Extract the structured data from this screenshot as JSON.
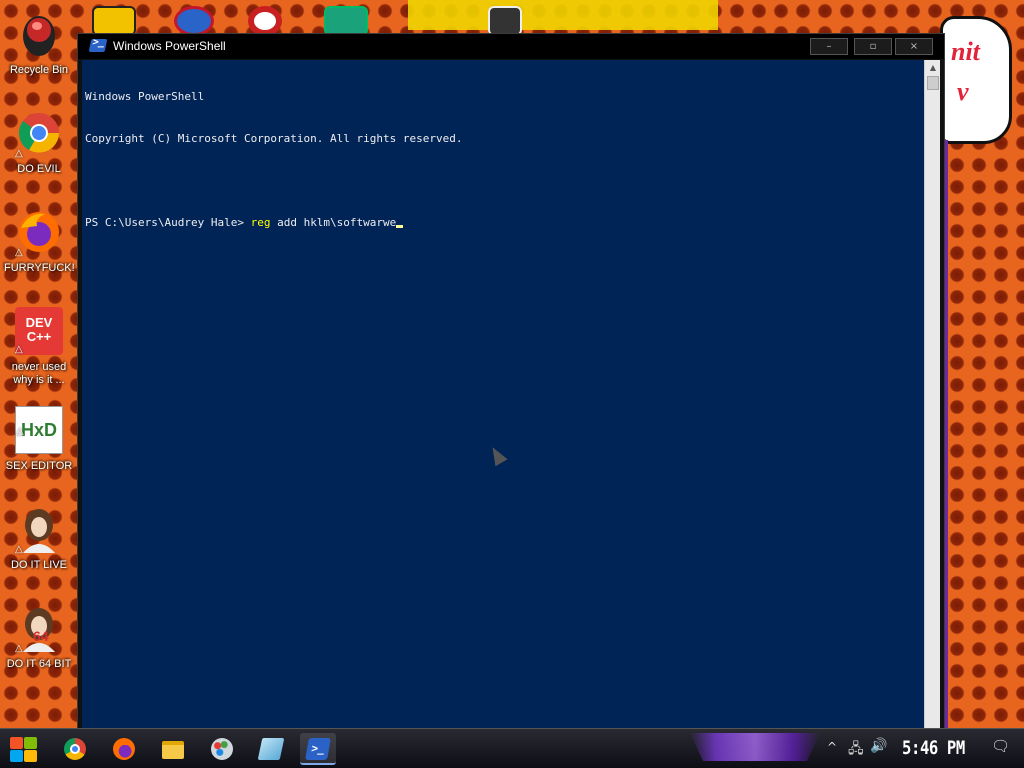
{
  "desktop": {
    "icons": [
      {
        "label": "Recycle Bin",
        "icon": "recycle-bin-icon",
        "shortcut": false
      },
      {
        "label": "DO EVIL",
        "icon": "chrome-icon",
        "shortcut": true
      },
      {
        "label": "FURRYFUCK!",
        "icon": "firefox-icon",
        "shortcut": true
      },
      {
        "label": "never used why is it ...",
        "icon": "devcpp-icon",
        "shortcut": true,
        "glyph_text": "DEV C++"
      },
      {
        "label": "SEX EDITOR",
        "icon": "hxd-icon",
        "shortcut": true,
        "glyph_text": "HxD"
      },
      {
        "label": "DO IT LIVE",
        "icon": "portrait-icon",
        "shortcut": true
      },
      {
        "label": "DO IT 64 BIT",
        "icon": "portrait-64-icon",
        "shortcut": true,
        "glyph_text": "64"
      }
    ],
    "comic_text": [
      "nit",
      "v"
    ]
  },
  "window": {
    "title": "Windows PowerShell",
    "controls": {
      "minimize": "–",
      "maximize": "▫",
      "close": "×"
    },
    "console_lines": [
      {
        "text": "Windows PowerShell"
      },
      {
        "text": "Copyright (C) Microsoft Corporation. All rights reserved."
      },
      {
        "text": ""
      }
    ],
    "prompt": "PS C:\\Users\\Audrey Hale> ",
    "command_keyword": "reg",
    "command_args": " add hklm\\softwarwe",
    "colors": {
      "console_bg": "#012456",
      "console_text": "#eeedf0",
      "command": "#ffff00"
    }
  },
  "taskbar": {
    "apps": [
      {
        "name": "chrome",
        "icon": "chrome-icon",
        "active": false
      },
      {
        "name": "firefox",
        "icon": "firefox-icon",
        "active": false
      },
      {
        "name": "file-explorer",
        "icon": "folder-icon",
        "active": false
      },
      {
        "name": "paint",
        "icon": "paint-palette-icon",
        "active": false
      },
      {
        "name": "notepad",
        "icon": "notepad-icon",
        "active": false
      },
      {
        "name": "powershell",
        "icon": "powershell-icon",
        "active": true
      }
    ],
    "tray": {
      "chevron": "^",
      "network": "network-icon",
      "volume": "volume-icon",
      "notifications": "notification-icon"
    },
    "clock": "5:46 PM"
  }
}
